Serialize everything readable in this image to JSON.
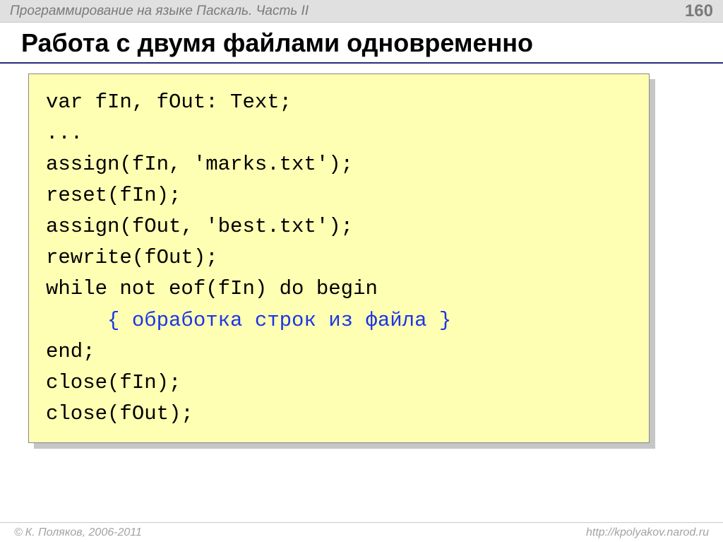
{
  "header": {
    "title": "Программирование на языке Паскаль. Часть II",
    "page": "160"
  },
  "slide": {
    "title": "Работа с двумя файлами одновременно"
  },
  "code": {
    "line1": "var fIn, fOut: Text;",
    "line2": "...",
    "line3": "assign(fIn, 'marks.txt');",
    "line4": "reset(fIn);",
    "line5": "assign(fOut, 'best.txt');",
    "line6": "rewrite(fOut);",
    "line7": "while not eof(fIn) do begin",
    "line8_indent": "     ",
    "line8_comment": "{ обработка строк из файла }",
    "line9": "end;",
    "line10": "close(fIn);",
    "line11": "close(fOut);"
  },
  "footer": {
    "copyright_symbol": "©",
    "author": " К. Поляков, 2006-2011",
    "url": "http://kpolyakov.narod.ru"
  }
}
